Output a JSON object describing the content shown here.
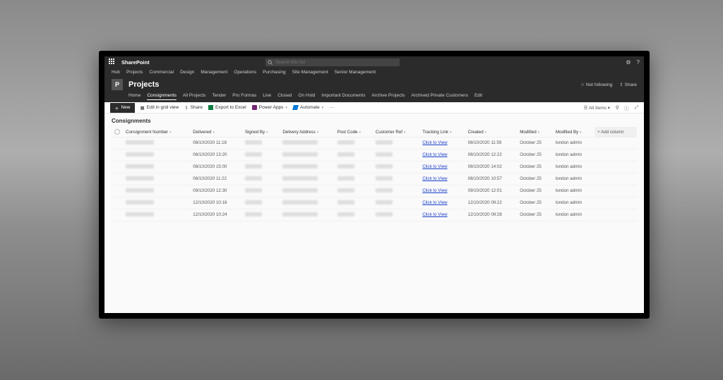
{
  "suite": {
    "brand": "SharePoint",
    "search_placeholder": "Search this list"
  },
  "hubnav": [
    "Hub",
    "Projects",
    "Commercial",
    "Design",
    "Management",
    "Operations",
    "Purchasing",
    "Site Management",
    "Senior Management"
  ],
  "site": {
    "logo_letter": "P",
    "title": "Projects",
    "not_following": "Not following",
    "share": "Share"
  },
  "sitenav": {
    "items": [
      "Home",
      "Consignments",
      "All Projects",
      "Tender",
      "Pro Formas",
      "Live",
      "Closed",
      "On Hold",
      "Important Documents",
      "Archive Projects",
      "Archived Private Customers",
      "Edit"
    ],
    "active_index": 1
  },
  "cmdbar": {
    "new": "New",
    "edit_grid": "Edit in grid view",
    "share": "Share",
    "export": "Export to Excel",
    "powerapps": "Power Apps",
    "automate": "Automate",
    "ellipsis": "···",
    "view_label": "All Items"
  },
  "list": {
    "title": "Consignments",
    "columns": [
      "Consignment Number",
      "Delivered",
      "Signed By",
      "Delivery Address",
      "Post Code",
      "Customer Ref",
      "Tracking Link",
      "Created",
      "Modified",
      "Modified By"
    ],
    "add_column": "Add column",
    "tracking_text": "Click to View",
    "rows": [
      {
        "delivered": "08/10/2020 11:18",
        "created": "08/10/2020 11:59",
        "modified": "October 25",
        "modified_by": "london admin"
      },
      {
        "delivered": "08/10/2020 13:20",
        "created": "08/10/2020 12:22",
        "modified": "October 25",
        "modified_by": "london admin"
      },
      {
        "delivered": "08/10/2020 15:00",
        "created": "08/10/2020 14:02",
        "modified": "October 25",
        "modified_by": "london admin"
      },
      {
        "delivered": "08/10/2020 11:22",
        "created": "08/10/2020 10:57",
        "modified": "October 25",
        "modified_by": "london admin"
      },
      {
        "delivered": "09/10/2020 12:30",
        "created": "09/10/2020 12:01",
        "modified": "October 25",
        "modified_by": "london admin"
      },
      {
        "delivered": "12/10/2020 10:18",
        "created": "12/10/2020 09:22",
        "modified": "October 25",
        "modified_by": "london admin"
      },
      {
        "delivered": "12/10/2020 10:24",
        "created": "12/10/2020 09:28",
        "modified": "October 25",
        "modified_by": "london admin"
      }
    ]
  }
}
